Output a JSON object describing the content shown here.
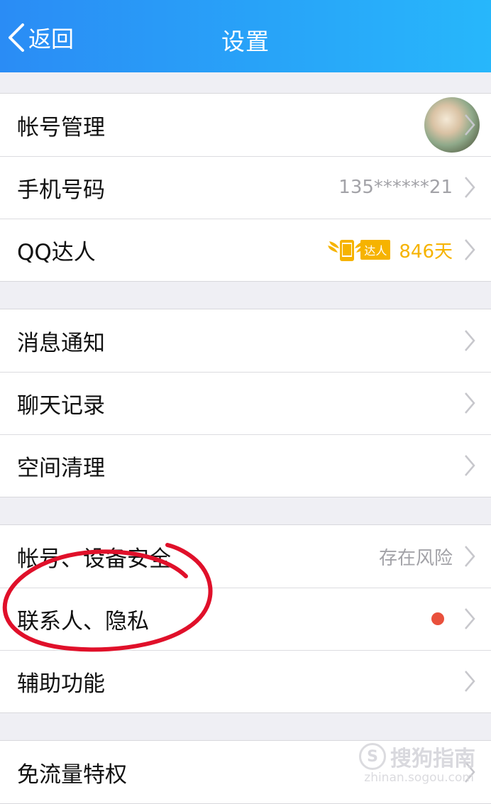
{
  "nav": {
    "back_label": "返回",
    "title": "设置",
    "back_icon": "chevron-left-icon"
  },
  "groups": [
    {
      "rows": [
        {
          "label": "帐号管理",
          "accessory": "avatar"
        },
        {
          "label": "手机号码",
          "value": "135******21"
        },
        {
          "label": "QQ达人",
          "badge_text": "达人",
          "badge_icon": "winged-phone-icon",
          "value": "846天"
        }
      ]
    },
    {
      "rows": [
        {
          "label": "消息通知"
        },
        {
          "label": "聊天记录"
        },
        {
          "label": "空间清理"
        }
      ]
    },
    {
      "rows": [
        {
          "label": "帐号、设备安全",
          "value": "存在风险"
        },
        {
          "label": "联系人、隐私",
          "indicator": "red-dot"
        },
        {
          "label": "辅助功能"
        }
      ]
    },
    {
      "rows": [
        {
          "label": "免流量特权"
        }
      ]
    }
  ],
  "watermark": {
    "logo_text": "S",
    "text": "搜狗指南",
    "url": "zhinan.sogou.com"
  },
  "colors": {
    "nav_gradient_start": "#2a8cf5",
    "nav_gradient_end": "#27b7fb",
    "value_orange": "#f6b300",
    "red_dot": "#e9503c",
    "annotation_red": "#e0102a"
  }
}
